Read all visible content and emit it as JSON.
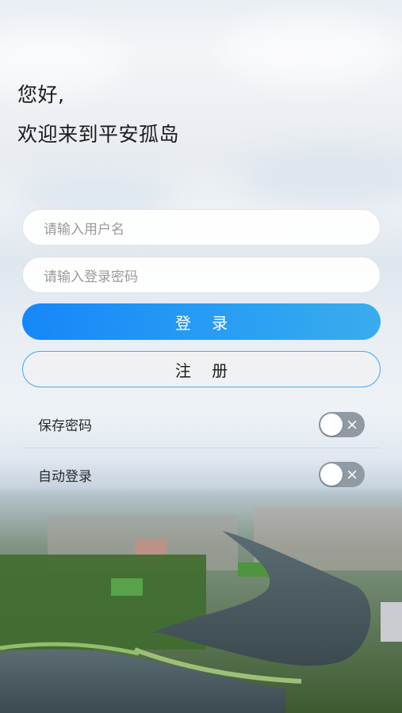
{
  "greeting": {
    "line1": "您好,",
    "line2": "欢迎来到平安孤岛"
  },
  "form": {
    "username_placeholder": "请输入用户名",
    "password_placeholder": "请输入登录密码",
    "login_label": "登 录",
    "register_label": "注 册"
  },
  "options": {
    "save_password": {
      "label": "保存密码",
      "enabled": false
    },
    "auto_login": {
      "label": "自动登录",
      "enabled": false
    }
  },
  "colors": {
    "primary": "#1786f8",
    "register_border": "#4aa8f3",
    "toggle_off": "#8f9aa3"
  },
  "icons": {
    "toggle_off": "close-x-icon"
  }
}
